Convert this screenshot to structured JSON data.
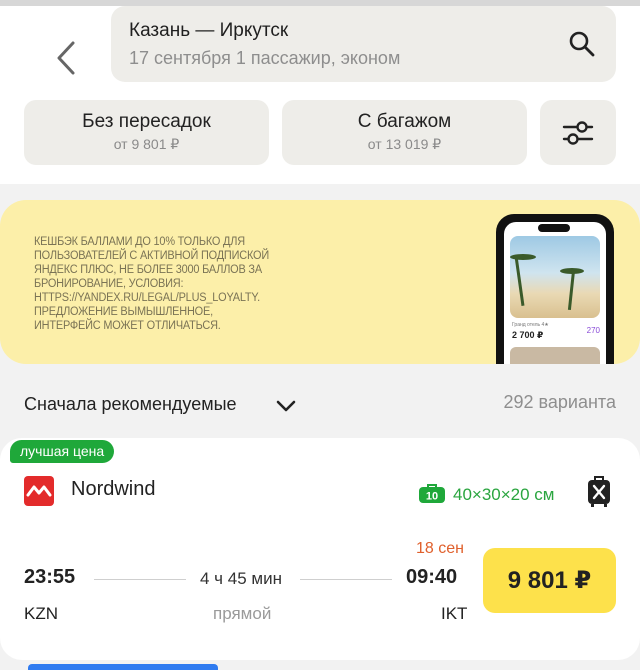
{
  "search": {
    "route": "Казань — Иркутск",
    "details": "17 сентября   1 пассажир, эконом",
    "back_icon": "chevron-left-icon",
    "search_icon": "search-icon"
  },
  "filters": [
    {
      "title": "Без пересадок",
      "price": "от 9 801 ₽"
    },
    {
      "title": "С багажом",
      "price": "от 13 019 ₽"
    }
  ],
  "filter_settings_icon": "sliders-icon",
  "promo": {
    "text": "Кешбэк баллами до 10% только для пользователей с активной подпиской Яндекс Плюс, не более 3000 баллов за бронирование, условия: https://yandex.ru/legal/plus_loyalty. Предложение вымышленное, интерфейс может отличаться.",
    "phone_caption": "Гранд отель 4★",
    "phone_price": "2 700 ₽",
    "phone_badge": "270"
  },
  "sort": {
    "label": "Сначала рекомендуемые",
    "count": "292 варианта"
  },
  "result": {
    "badge": "лучшая цена",
    "airline": "Nordwind",
    "bag_count": "10",
    "bag_dims": "40×30×20 см",
    "dep_time": "23:55",
    "arr_time": "09:40",
    "arr_date": "18 сен",
    "duration": "4 ч 45 мин",
    "dep_code": "KZN",
    "arr_code": "IKT",
    "stops": "прямой",
    "price": "9 801 ₽"
  },
  "colors": {
    "accent_yellow": "#fde14b",
    "green": "#1fa83a",
    "promo_bg": "#fcefa9",
    "airline_red": "#e32b2b",
    "date_orange": "#e0602c"
  }
}
